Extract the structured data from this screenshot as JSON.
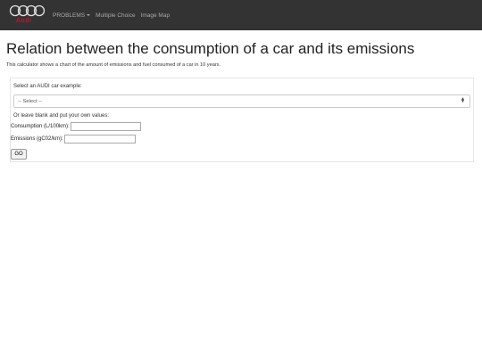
{
  "navbar": {
    "brand": "Audi",
    "items": [
      "PROBLEMS",
      "Multiple Choice",
      "Image Map"
    ]
  },
  "page": {
    "title": "Relation between the consumption of a car and its emissions",
    "description": "This calculator shows a chart of the amount of emissions and fuel consumed of a car in 10 years."
  },
  "form": {
    "select_label": "Select an AUDI car example:",
    "select_value": "-- Select --",
    "alt_label": "Or leave blank and put your own values:",
    "consumption_label": "Consumption (L/100km):",
    "consumption_value": "",
    "emissions_label": "Emissions (gC02/km):",
    "emissions_value": "",
    "go_label": "GO"
  },
  "colors": {
    "navbar_bg": "#333334",
    "brand_red": "#c8102e"
  }
}
